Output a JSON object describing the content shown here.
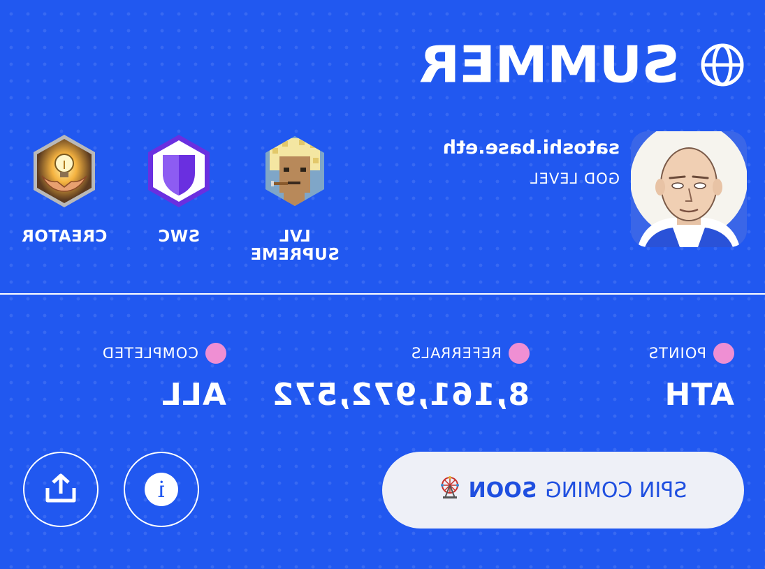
{
  "header": {
    "wordmark": "SUMMER",
    "globe_icon": "globe-icon"
  },
  "profile": {
    "username": "satoshi.base.eth",
    "level": "GOD LEVEL",
    "avatar_icon": "bald-man-avatar"
  },
  "badges": [
    {
      "label": "LVL SUPREME",
      "icon": "pixel-punk-icon"
    },
    {
      "label": "SWC",
      "icon": "shield-icon"
    },
    {
      "label": "CREATOR",
      "icon": "lightbulb-hands-icon"
    }
  ],
  "stats": [
    {
      "label": "POINTS",
      "value": "ATH"
    },
    {
      "label": "REFERRALS",
      "value": "8,161,972,572"
    },
    {
      "label": "COMPLETED",
      "value": "ALL"
    }
  ],
  "actions": {
    "spin_prefix": "SPIN COMING",
    "spin_emphasis": "SOON",
    "spin_icon": "ferris-wheel-icon",
    "info_icon": "info-icon",
    "info_glyph": "i",
    "share_icon": "share-upload-icon"
  },
  "colors": {
    "background": "#2158f0",
    "dot_accent": "#ef8fd3",
    "button_bg": "#eef0f7",
    "button_text": "#1f4fe0"
  }
}
